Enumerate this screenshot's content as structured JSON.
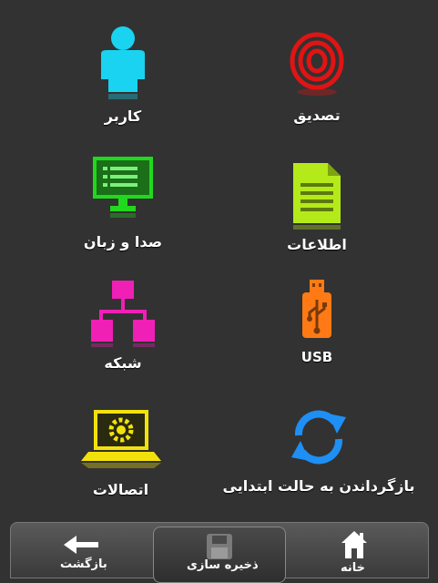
{
  "menu": {
    "user_label": "کاربر",
    "verify_label": "تصدیق",
    "sound_label": "صدا و زبان",
    "info_label": "اطلاعات",
    "network_label": "شبکه",
    "usb_label": "USB",
    "connections_label": "اتصالات",
    "reset_label": "بازگرداندن به حالت ابتدایی"
  },
  "colors": {
    "user": "#19d3f0",
    "verify": "#e01414",
    "sound": "#22d81e",
    "info": "#b5ea1a",
    "network": "#f01fb6",
    "usb": "#ff7a14",
    "connections": "#f2e20c",
    "reset": "#1e8ff5"
  },
  "bottom_bar": {
    "back_label": "بازگشت",
    "save_label": "ذخیره سازی",
    "home_label": "خانه"
  }
}
